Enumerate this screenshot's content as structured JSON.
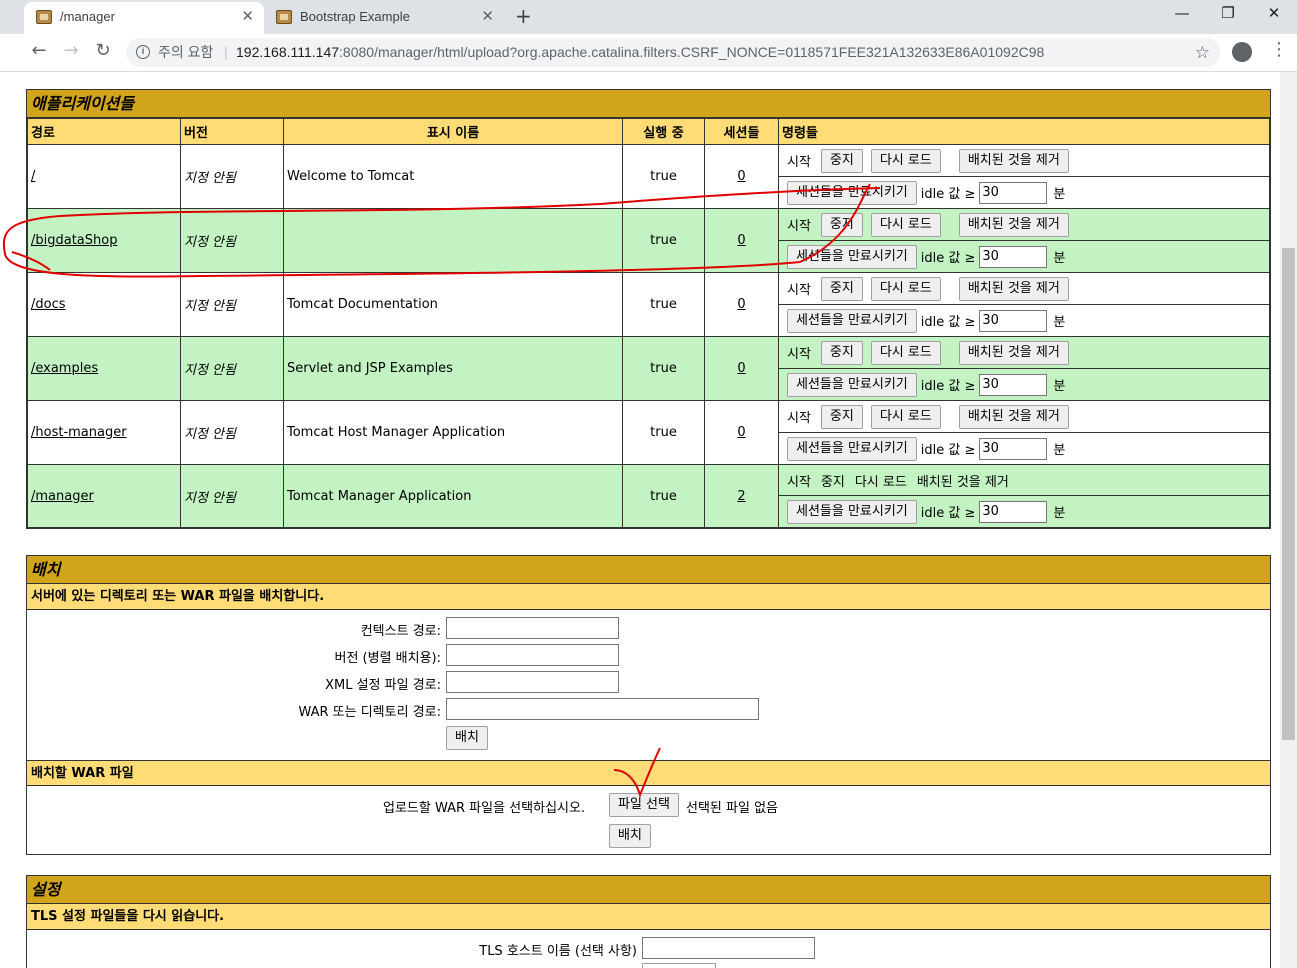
{
  "browser": {
    "tabs": [
      {
        "title": "/manager",
        "active": true
      },
      {
        "title": "Bootstrap Example",
        "active": false
      }
    ],
    "new_tab": "+",
    "window_controls": {
      "minimize": "—",
      "restore": "❐",
      "close": "✕"
    },
    "nav": {
      "back": "←",
      "forward": "→",
      "reload": "↻"
    },
    "address": {
      "security_label": "주의 요함",
      "separator": "|",
      "host": "192.168.111.147",
      "rest": ":8080/manager/html/upload?org.apache.catalina.filters.CSRF_NONCE=0118571FEE321A132633E86A01092C98"
    }
  },
  "applications": {
    "title": "애플리케이션들",
    "headers": {
      "path": "경로",
      "version": "버전",
      "display_name": "표시 이름",
      "running": "실행 중",
      "sessions": "세션들",
      "commands": "명령들"
    },
    "rows": [
      {
        "path": "/",
        "version": "지정 안됨",
        "display_name": "Welcome to Tomcat",
        "running": "true",
        "sessions": "0",
        "buttons": true
      },
      {
        "path": "/bigdataShop",
        "version": "지정 안됨",
        "display_name": "",
        "running": "true",
        "sessions": "0",
        "buttons": true
      },
      {
        "path": "/docs",
        "version": "지정 안됨",
        "display_name": "Tomcat Documentation",
        "running": "true",
        "sessions": "0",
        "buttons": true
      },
      {
        "path": "/examples",
        "version": "지정 안됨",
        "display_name": "Servlet and JSP Examples",
        "running": "true",
        "sessions": "0",
        "buttons": true
      },
      {
        "path": "/host-manager",
        "version": "지정 안됨",
        "display_name": "Tomcat Host Manager Application",
        "running": "true",
        "sessions": "0",
        "buttons": true
      },
      {
        "path": "/manager",
        "version": "지정 안됨",
        "display_name": "Tomcat Manager Application",
        "running": "true",
        "sessions": "2",
        "buttons": false
      }
    ],
    "commands": {
      "start": "시작",
      "stop": "중지",
      "reload": "다시 로드",
      "undeploy": "배치된 것을 제거",
      "expire": "세션들을 만료시키기",
      "idle_label": "idle 값 ≥",
      "idle_value": "30",
      "minutes": "분"
    }
  },
  "deploy": {
    "title": "배치",
    "dir_heading": "서버에 있는 디렉토리 또는 WAR 파일을 배치합니다.",
    "context_path_label": "컨텍스트 경로:",
    "version_label": "버전 (병렬 배치용):",
    "xml_label": "XML 설정 파일 경로:",
    "war_dir_label": "WAR 또는 디렉토리 경로:",
    "deploy_button": "배치",
    "war_heading": "배치할 WAR 파일",
    "upload_label": "업로드할 WAR 파일을 선택하십시오.",
    "choose_file_button": "파일 선택",
    "no_file_text": "선택된 파일 없음",
    "war_deploy_button": "배치"
  },
  "settings": {
    "title": "설정",
    "tls_heading": "TLS 설정 파일들을 다시 읽습니다.",
    "tls_host_label": "TLS 호스트 이름 (선택 사항)"
  },
  "colors": {
    "panel_title": "#d2a41c",
    "subhead": "#ffdc75",
    "row_even": "#c3f3c3",
    "annotation": "#e00000"
  }
}
